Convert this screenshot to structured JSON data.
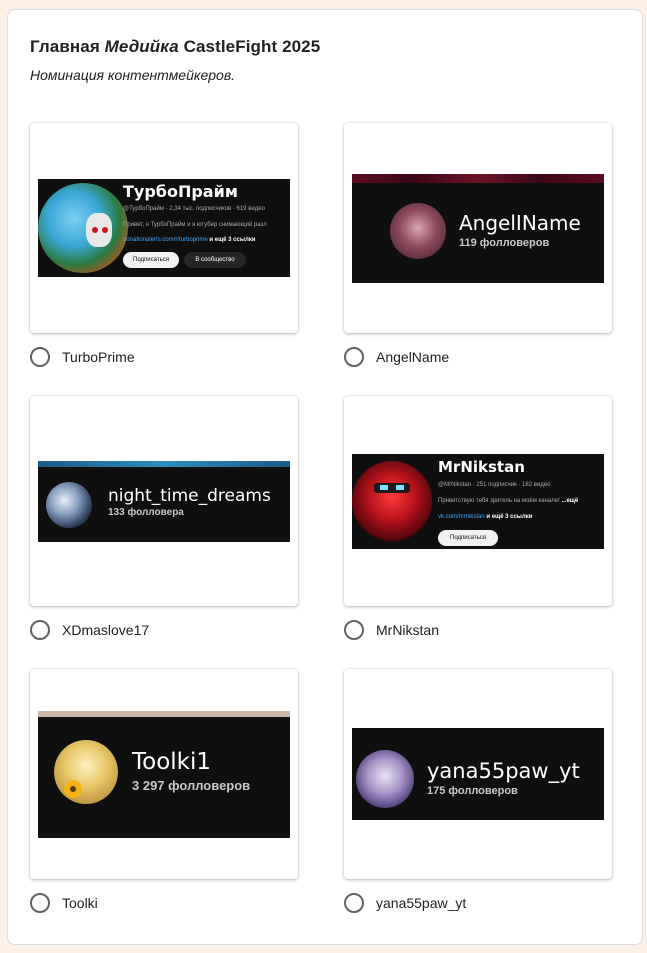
{
  "form": {
    "title_prefix": "Главная ",
    "title_italic": "Медийка",
    "title_suffix": " CastleFight 2025",
    "subtitle": "Номинация контентмейкеров."
  },
  "options": [
    {
      "label": "TurboPrime",
      "banner": {
        "style": "youtube",
        "name": "ТурбоПрайм",
        "handle_stats": "@ТурбоПрайм · 2,34 тыс. подписчиков · 619 видео",
        "description": "Привет, я ТурбоПрайм и я ютубер снимающий разл",
        "link": "donationalerts.com/r/turboprime",
        "link_more": " и ещё 3 ссылки",
        "subscribe": "Подписаться",
        "community": "В сообщество"
      }
    },
    {
      "label": "AngelName",
      "banner": {
        "style": "twitch",
        "name": "AngelIName",
        "followers": "119 фолловеров"
      }
    },
    {
      "label": "XDmaslove17",
      "banner": {
        "style": "twitch",
        "name": "night_time_dreams",
        "followers": "133 фолловера"
      }
    },
    {
      "label": "MrNikstan",
      "banner": {
        "style": "youtube",
        "name": "MrNikstan",
        "handle_stats": "@MrNikstan · 251 подписчик · 182 видео",
        "description": "Приветствую тебя зритель на моём канале!",
        "description_more": "...ещё",
        "link": "vk.com/mrnikstan",
        "link_more": " и ещё 3 ссылки",
        "subscribe": "Подписаться"
      }
    },
    {
      "label": "Toolki",
      "banner": {
        "style": "twitch",
        "name": "Toolki1",
        "followers": "3 297 фолловеров"
      }
    },
    {
      "label": "yana55paw_yt",
      "banner": {
        "style": "twitch",
        "name": "yana55paw_yt",
        "followers": "175 фолловеров"
      }
    }
  ],
  "colors": {
    "page_bg": "#fcefe6",
    "banner_bg": "#0f0f0f",
    "link_blue": "#3ea6ff"
  }
}
